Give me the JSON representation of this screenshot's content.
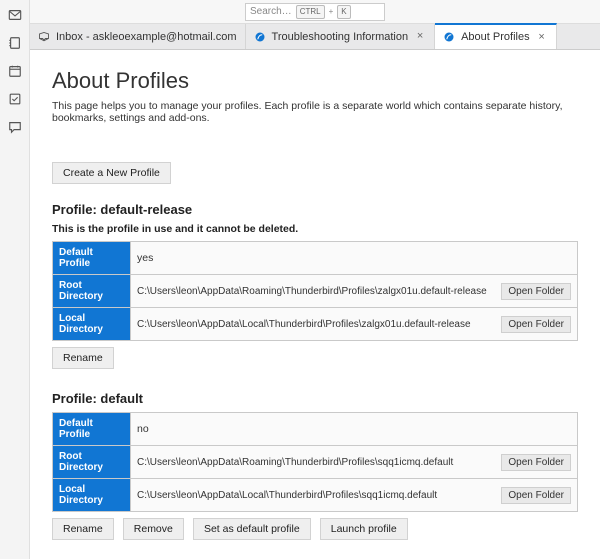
{
  "topbar": {
    "search_placeholder": "Search…",
    "kbd1": "CTRL",
    "kbd_plus": "+",
    "kbd2": "K"
  },
  "tabs": [
    {
      "label": "Inbox - askleoexample@hotmail.com",
      "icon": "inbox"
    },
    {
      "label": "Troubleshooting Information",
      "icon": "app",
      "closable": true
    },
    {
      "label": "About Profiles",
      "icon": "app",
      "closable": true,
      "active": true
    }
  ],
  "page": {
    "title": "About Profiles",
    "intro": "This page helps you to manage your profiles. Each profile is a separate world which contains separate history, bookmarks, settings and add-ons.",
    "create_label": "Create a New Profile",
    "open_folder_label": "Open Folder",
    "rename_label": "Rename",
    "remove_label": "Remove",
    "set_default_label": "Set as default profile",
    "launch_label": "Launch profile",
    "th_default": "Default Profile",
    "th_root": "Root Directory",
    "th_local": "Local Directory"
  },
  "profiles": [
    {
      "heading": "Profile: default-release",
      "note": "This is the profile in use and it cannot be deleted.",
      "is_default": "yes",
      "root_dir": "C:\\Users\\leon\\AppData\\Roaming\\Thunderbird\\Profiles\\zalgx01u.default-release",
      "local_dir": "C:\\Users\\leon\\AppData\\Local\\Thunderbird\\Profiles\\zalgx01u.default-release",
      "can_remove": false
    },
    {
      "heading": "Profile: default",
      "note": "",
      "is_default": "no",
      "root_dir": "C:\\Users\\leon\\AppData\\Roaming\\Thunderbird\\Profiles\\sqq1icmq.default",
      "local_dir": "C:\\Users\\leon\\AppData\\Local\\Thunderbird\\Profiles\\sqq1icmq.default",
      "can_remove": true
    }
  ]
}
